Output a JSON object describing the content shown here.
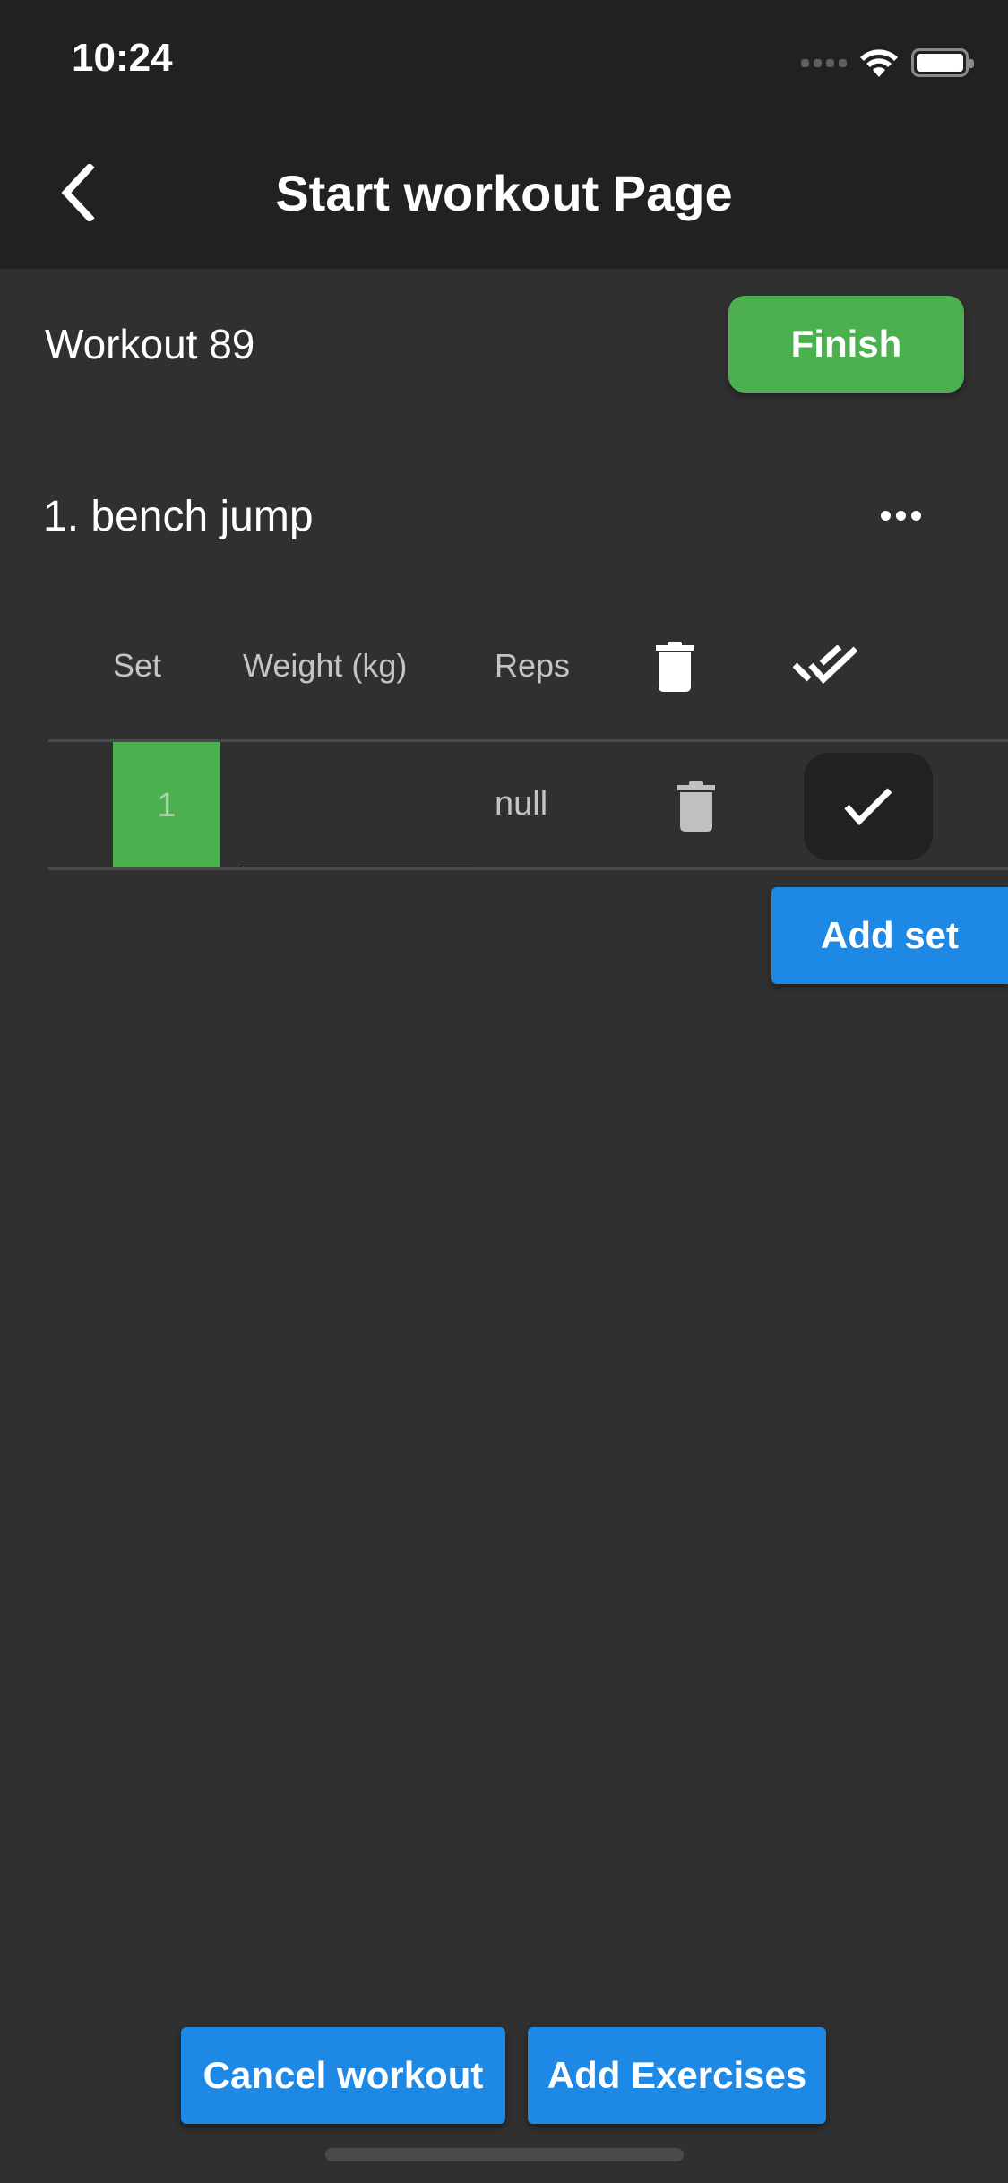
{
  "status_bar": {
    "time": "10:24",
    "icons": [
      "signal-dots-icon",
      "wifi-icon",
      "battery-icon"
    ],
    "battery_level": 1.0
  },
  "app_bar": {
    "title": "Start workout Page",
    "back_icon": "chevron-left-icon"
  },
  "workout": {
    "name": "Workout 89",
    "finish_label": "Finish"
  },
  "exercises": [
    {
      "title": "1. bench jump",
      "menu_icon": "more-horizontal-icon",
      "columns": {
        "set": "Set",
        "weight": "Weight (kg)",
        "reps": "Reps",
        "delete_icon": "trash-icon",
        "complete_all_icon": "double-check-icon"
      },
      "sets": [
        {
          "set": "1",
          "weight_value": "",
          "reps": "null",
          "delete_icon": "trash-icon",
          "check_icon": "check-icon"
        }
      ],
      "add_set_label": "Add set"
    }
  ],
  "footer": {
    "cancel_label": "Cancel workout",
    "add_exercises_label": "Add Exercises"
  },
  "colors": {
    "background": "#303030",
    "appbar": "#212121",
    "finish_green": "#4caf50",
    "button_blue": "#1e88e5",
    "header_text": "#c4c4c4"
  }
}
